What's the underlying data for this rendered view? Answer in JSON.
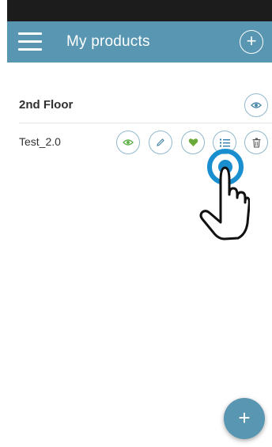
{
  "appbar": {
    "title": "My products",
    "add_icon": "plus-circle-icon",
    "menu_icon": "hamburger-menu-icon"
  },
  "groups": [
    {
      "name": "2nd Floor",
      "action_icon": "eye-icon",
      "products": [
        {
          "name": "Test_2.0",
          "actions": [
            "eye-icon",
            "pencil-icon",
            "heart-icon",
            "list-icon",
            "trash-icon"
          ]
        }
      ]
    }
  ],
  "fab": {
    "label": "+"
  },
  "colors": {
    "appbar": "#5896b2",
    "status_bar": "#1c1c1c",
    "button_border": "#8fb9cc",
    "eye_green": "#5fb14a",
    "heart_green": "#6aaa3a",
    "list_blue": "#2f7fb0",
    "tap_ring": "#1a8fd0"
  },
  "overlay": {
    "icon": "tap-hand-icon"
  }
}
